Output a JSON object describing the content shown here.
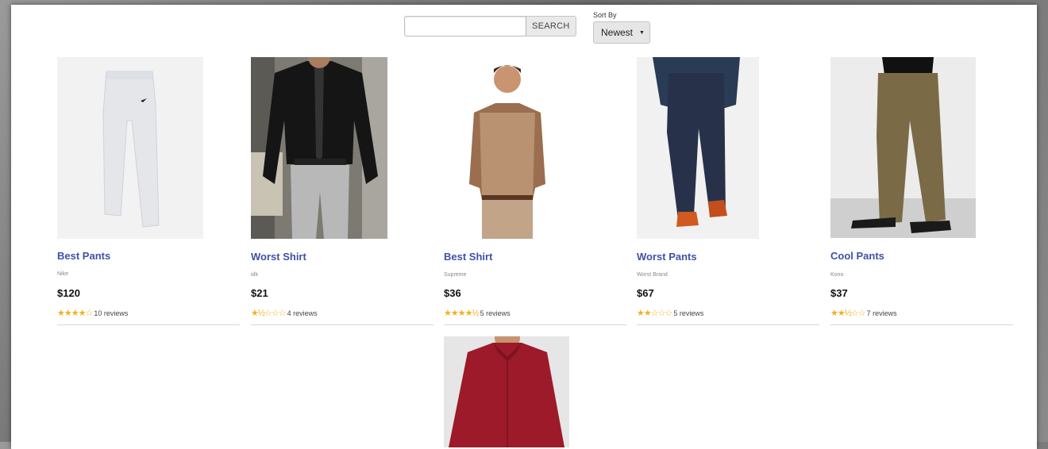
{
  "search": {
    "placeholder": "",
    "value": "",
    "button_label": "SEARCH"
  },
  "sort": {
    "label": "Sort By",
    "selected": "Newest",
    "arrow": "▼"
  },
  "products": [
    {
      "name": "Best Pants",
      "brand": "Nike",
      "price": "$120",
      "stars": "★★★★☆",
      "reviews": "10 reviews"
    },
    {
      "name": "Worst Shirt",
      "brand": "idk",
      "price": "$21",
      "stars": "★½☆☆☆",
      "reviews": "4 reviews"
    },
    {
      "name": "Best Shirt",
      "brand": "Supreme",
      "price": "$36",
      "stars": "★★★★½",
      "reviews": "5 reviews"
    },
    {
      "name": "Worst Pants",
      "brand": "Worst Brand",
      "price": "$67",
      "stars": "★★☆☆☆",
      "reviews": "5 reviews"
    },
    {
      "name": "Cool Pants",
      "brand": "Kono",
      "price": "$37",
      "stars": "★★½☆☆",
      "reviews": "7 reviews"
    }
  ],
  "colors": {
    "link": "#3f51a8",
    "star": "#f2b01e"
  }
}
